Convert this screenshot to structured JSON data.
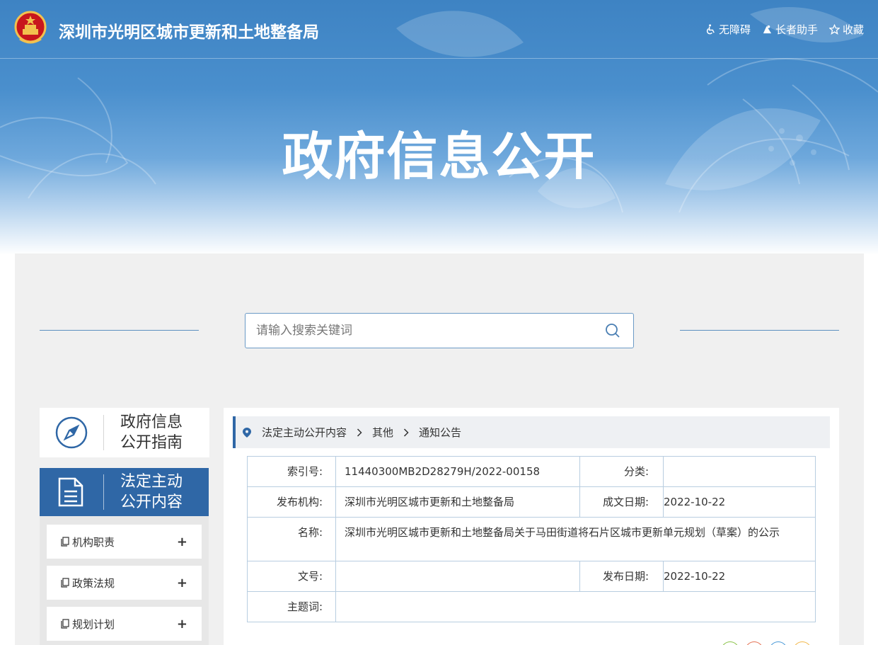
{
  "header": {
    "site_title": "深圳市光明区城市更新和土地整备局",
    "tools": [
      "无障碍",
      "长者助手",
      "收藏"
    ],
    "hero_title": "政府信息公开"
  },
  "search": {
    "placeholder": "请输入搜索关键词"
  },
  "sidebar": {
    "guide": {
      "line1": "政府信息",
      "line2": "公开指南"
    },
    "active": {
      "line1": "法定主动",
      "line2": "公开内容"
    },
    "items": [
      {
        "label": "机构职责"
      },
      {
        "label": "政策法规"
      },
      {
        "label": "规划计划"
      }
    ],
    "expand_symbol": "+"
  },
  "breadcrumb": [
    "法定主动公开内容",
    "其他",
    "通知公告"
  ],
  "info": {
    "index_label": "索引号:",
    "index_value": "11440300MB2D28279H/2022-00158",
    "category_label": "分类:",
    "category_value": "",
    "publisher_label": "发布机构:",
    "publisher_value": "深圳市光明区城市更新和土地整备局",
    "written_date_label": "成文日期:",
    "written_date_value": "2022-10-22",
    "name_label": "名称:",
    "name_value": "深圳市光明区城市更新和土地整备局关于马田街道将石片区城市更新单元规划（草案）的公示",
    "doc_no_label": "文号:",
    "doc_no_value": "",
    "publish_date_label": "发布日期:",
    "publish_date_value": "2022-10-22",
    "subject_label": "主题词:",
    "subject_value": ""
  },
  "colors": {
    "accent": "#2f67a6",
    "banner_blue": "#4a8fcd",
    "panel_gray": "#f0f0f0",
    "table_border": "#b8cde0"
  }
}
